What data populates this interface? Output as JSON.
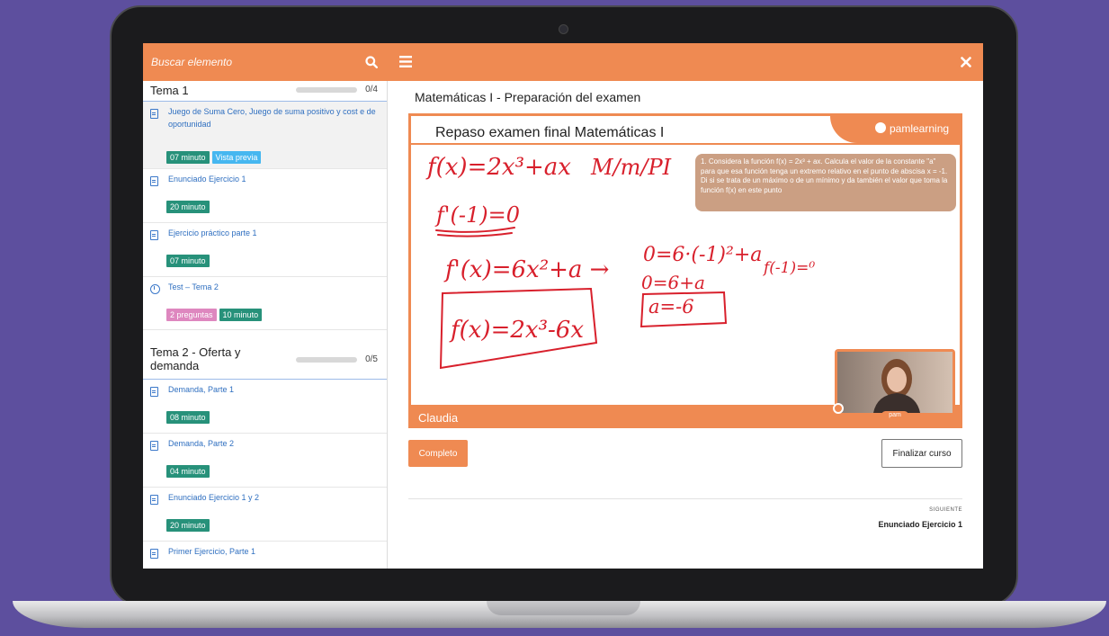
{
  "search": {
    "placeholder": "Buscar elemento"
  },
  "sidebar": {
    "sections": [
      {
        "title": "Tema 1",
        "progress": {
          "label": "0/4",
          "fraction": 0
        },
        "lessons": [
          {
            "title": "Juego de Suma Cero, Juego de suma positivo y cost e de oportunidad",
            "icon": "document-icon",
            "badges": [
              "07 minuto",
              "Vista previa"
            ]
          },
          {
            "title": "Enunciado Ejercicio 1",
            "icon": "document-icon",
            "badges": [
              "20 minuto"
            ]
          },
          {
            "title": "Ejercicio práctico parte 1",
            "icon": "document-icon",
            "badges": [
              "07 minuto"
            ]
          },
          {
            "title": "Test – Tema 2",
            "icon": "clock-icon",
            "badges": [
              "2 preguntas",
              "10 minuto"
            ]
          }
        ]
      },
      {
        "title": "Tema 2 - Oferta y demanda",
        "progress": {
          "label": "0/5",
          "fraction": 0
        },
        "lessons": [
          {
            "title": "Demanda, Parte 1",
            "icon": "document-icon",
            "badges": [
              "08 minuto"
            ]
          },
          {
            "title": "Demanda, Parte 2",
            "icon": "document-icon",
            "badges": [
              "04 minuto"
            ]
          },
          {
            "title": "Enunciado Ejercicio 1 y 2",
            "icon": "document-icon",
            "badges": [
              "20 minuto"
            ]
          },
          {
            "title": "Primer Ejercicio, Parte 1",
            "icon": "document-icon",
            "badges": []
          }
        ]
      }
    ]
  },
  "main": {
    "title": "Matemáticas I - Preparación del examen",
    "video": {
      "slide_title": "Repaso examen final Matemáticas I",
      "brand": "pamlearning",
      "question": "1.  Considera la función f(x) = 2x³ + ax. Calcula el valor de la constante \"a\" para que esa función tenga un extremo relativo en el punto de abscisa x = -1. Di si se trata de un máximo o de un mínimo y da también el valor que toma la función f(x) en este punto",
      "handwriting": [
        "f(x)=2x³+ax",
        "M/m/PI",
        "f'(-1)=0",
        "f'(x)=6x²+a →",
        "0=6·(-1)²+a",
        "f(-1)=⁰",
        "0=6+a",
        "a=-6",
        "f(x)=2x³-6x"
      ],
      "speaker": "Claudia",
      "webcam_label": "pam"
    },
    "complete_label": "Completo",
    "finish_label": "Finalizar curso",
    "next": {
      "label": "SIGUIENTE",
      "title": "Enunciado Ejercicio 1"
    }
  },
  "colors": {
    "accent": "#ef8a52",
    "badge_green": "#27917a",
    "badge_blue": "#46b7f0",
    "badge_pink": "#de87bf",
    "link": "#2f6fc0",
    "ink": "#d8202c",
    "background": "#5d4f9e"
  },
  "icons": {
    "search": "search-icon",
    "menu": "hamburger-menu-icon",
    "close": "close-icon"
  }
}
